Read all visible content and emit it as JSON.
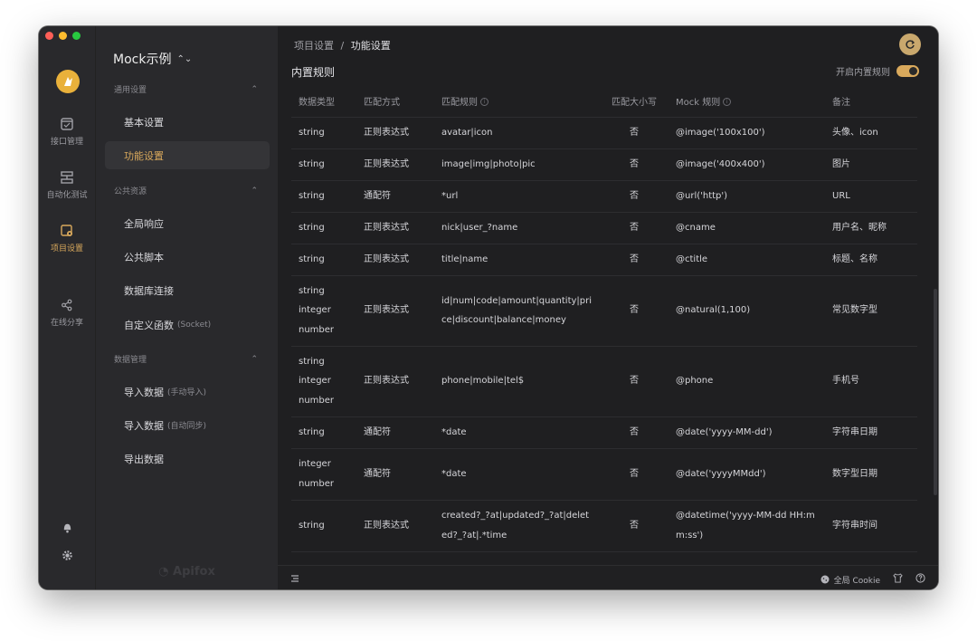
{
  "rail": {
    "items": [
      {
        "label": "接口管理",
        "icon": "api-doc-icon"
      },
      {
        "label": "自动化测试",
        "icon": "automation-icon"
      },
      {
        "label": "项目设置",
        "icon": "project-settings-icon"
      },
      {
        "label": "在线分享",
        "icon": "share-icon"
      }
    ]
  },
  "nav": {
    "project_name": "Mock示例",
    "groups": [
      {
        "label": "通用设置",
        "items": [
          "基本设置",
          "功能设置"
        ]
      },
      {
        "label": "公共资源",
        "items": [
          "全局响应",
          "公共脚本",
          "数据库连接"
        ]
      },
      {
        "label": "数据管理",
        "items": []
      }
    ],
    "custom_func": {
      "label": "自定义函数",
      "sub": "(Socket)"
    },
    "import_manual": {
      "label": "导入数据",
      "sub": "(手动导入)"
    },
    "import_auto": {
      "label": "导入数据",
      "sub": "(自动同步)"
    },
    "export": "导出数据",
    "footer": "Apifox"
  },
  "main": {
    "breadcrumb": [
      "项目设置",
      "/",
      "功能设置"
    ],
    "section_title": "内置规则",
    "toggle_label": "开启内置规则",
    "toggle_on": true,
    "columns": [
      "数据类型",
      "匹配方式",
      "匹配规则",
      "匹配大小写",
      "Mock 规则",
      "备注"
    ],
    "rows": [
      {
        "type": [
          "string"
        ],
        "method": "正则表达式",
        "rule": "avatar|icon",
        "case": "否",
        "mock": "@image('100x100')",
        "note": "头像、icon"
      },
      {
        "type": [
          "string"
        ],
        "method": "正则表达式",
        "rule": "image|img|photo|pic",
        "case": "否",
        "mock": "@image('400x400')",
        "note": "图片"
      },
      {
        "type": [
          "string"
        ],
        "method": "通配符",
        "rule": "*url",
        "case": "否",
        "mock": "@url('http')",
        "note": "URL"
      },
      {
        "type": [
          "string"
        ],
        "method": "正则表达式",
        "rule": "nick|user_?name",
        "case": "否",
        "mock": "@cname",
        "note": "用户名、昵称"
      },
      {
        "type": [
          "string"
        ],
        "method": "正则表达式",
        "rule": "title|name",
        "case": "否",
        "mock": "@ctitle",
        "note": "标题、名称"
      },
      {
        "type": [
          "string",
          "integer",
          "number"
        ],
        "method": "正则表达式",
        "rule": "id|num|code|amount|quantity|price|discount|balance|money",
        "case": "否",
        "mock": "@natural(1,100)",
        "note": "常见数字型"
      },
      {
        "type": [
          "string",
          "integer",
          "number"
        ],
        "method": "正则表达式",
        "rule": "phone|mobile|tel$",
        "case": "否",
        "mock": "@phone",
        "note": "手机号"
      },
      {
        "type": [
          "string"
        ],
        "method": "通配符",
        "rule": "*date",
        "case": "否",
        "mock": "@date('yyyy-MM-dd')",
        "note": "字符串日期"
      },
      {
        "type": [
          "integer",
          "number"
        ],
        "method": "通配符",
        "rule": "*date",
        "case": "否",
        "mock": "@date('yyyyMMdd')",
        "note": "数字型日期"
      },
      {
        "type": [
          "string"
        ],
        "method": "正则表达式",
        "rule": "created?_?at|updated?_?at|deleted?_?at|.*time",
        "case": "否",
        "mock": "@datetime('yyyy-MM-dd HH:mm:ss')",
        "note": "字符串时间"
      }
    ]
  },
  "status": {
    "cookie_label": "全局 Cookie"
  },
  "colors": {
    "accent": "#d9a95c",
    "bg": "#1f1f21",
    "sidebar": "#29292c"
  }
}
